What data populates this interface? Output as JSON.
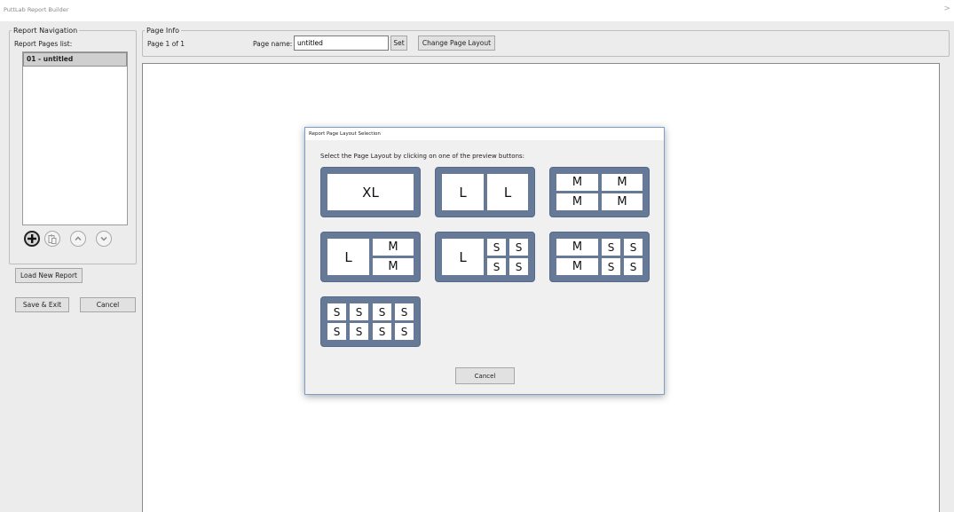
{
  "window": {
    "title": "PuttLab Report Builder",
    "corner_glyph": ">"
  },
  "navigation": {
    "legend": "Report Navigation",
    "pages_list_label": "Report Pages list:",
    "pages": [
      "01 - untitled"
    ],
    "load_button": "Load New Report",
    "save_exit_button": "Save & Exit",
    "cancel_button": "Cancel",
    "icons": [
      "plus-icon",
      "clipboard-icon",
      "chevron-up-icon",
      "chevron-down-icon"
    ]
  },
  "page_info": {
    "legend": "Page Info",
    "page_count": "Page 1 of 1",
    "page_name_label": "Page name:",
    "page_name_value": "untitled",
    "set_button": "Set",
    "change_layout_button": "Change Page Layout"
  },
  "dialog": {
    "title": "Report Page Layout Selection",
    "instruction": "Select the Page Layout by clicking on one of the preview buttons:",
    "cancel_button": "Cancel",
    "layout_color": "#667a98",
    "layouts": [
      {
        "cells": [
          "XL"
        ]
      },
      {
        "cells": [
          "L",
          "L"
        ]
      },
      {
        "cells": [
          "M",
          "M",
          "M",
          "M"
        ]
      },
      {
        "cells": [
          "L",
          "M",
          "M"
        ]
      },
      {
        "cells": [
          "L",
          "S",
          "S",
          "S",
          "S"
        ]
      },
      {
        "cells": [
          "M",
          "S",
          "S",
          "M",
          "S",
          "S"
        ]
      },
      {
        "cells": [
          "S",
          "S",
          "S",
          "S",
          "S",
          "S",
          "S",
          "S"
        ]
      }
    ]
  }
}
